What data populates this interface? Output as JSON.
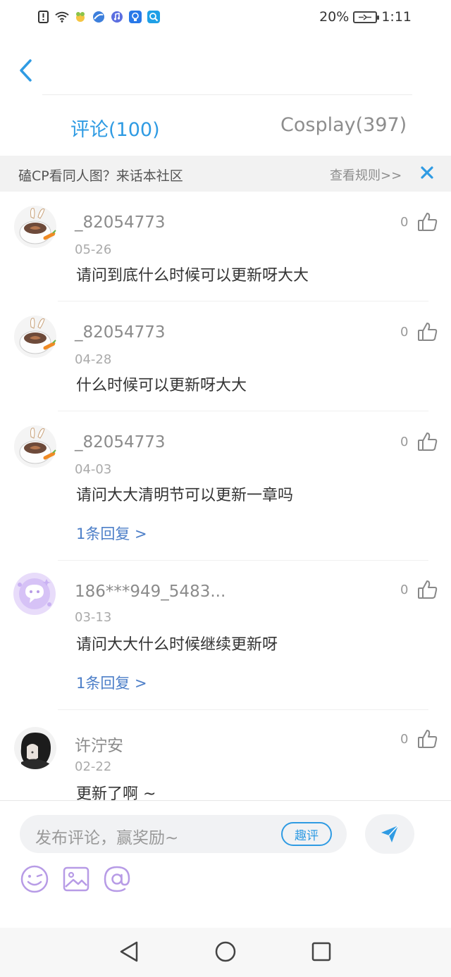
{
  "status_bar": {
    "battery": "20%",
    "time": "1:11",
    "icons": [
      "alert-icon",
      "wifi-icon",
      "app-icon",
      "browser-icon",
      "music-icon",
      "bulb-icon",
      "search-app-icon"
    ]
  },
  "tabs": [
    {
      "label": "评论(100)",
      "active": true
    },
    {
      "label": "Cosplay(397)",
      "active": false
    }
  ],
  "notice": {
    "text": "磕CP看同人图？来话本社区",
    "rules": "查看规则>>"
  },
  "comments": [
    {
      "user": "_82054773",
      "date": "05-26",
      "text": "请问到底什么时候可以更新呀大大",
      "likes": "0",
      "reply": ""
    },
    {
      "user": "_82054773",
      "date": "04-28",
      "text": "什么时候可以更新呀大大",
      "likes": "0",
      "reply": ""
    },
    {
      "user": "_82054773",
      "date": "04-03",
      "text": "请问大大清明节可以更新一章吗",
      "likes": "0",
      "reply": "1条回复 >"
    },
    {
      "user": "186***949_5483...",
      "date": "03-13",
      "text": "请问大大什么时候继续更新呀",
      "likes": "0",
      "reply": "1条回复 >"
    },
    {
      "user": "许泞安",
      "date": "02-22",
      "text": "更新了啊 ~",
      "likes": "0",
      "reply": ""
    }
  ],
  "composer": {
    "placeholder": "发布评论，赢奖励~",
    "quick_label": "趣评"
  },
  "colors": {
    "accent": "#2f9be3",
    "link": "#4d7fc8",
    "tool_icons": "#b79be6"
  }
}
